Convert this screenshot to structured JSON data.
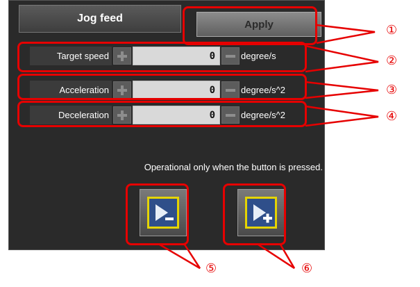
{
  "panel": {
    "title": "Jog feed",
    "apply_label": "Apply",
    "rows": [
      {
        "label": "Target speed",
        "value": "0",
        "unit": "degree/s"
      },
      {
        "label": "Acceleration",
        "value": "0",
        "unit": "degree/s^2"
      },
      {
        "label": "Deceleration",
        "value": "0",
        "unit": "degree/s^2"
      }
    ],
    "note": "Operational only when the button is pressed.",
    "jog_minus_icon": "play-minus-icon",
    "jog_plus_icon": "play-plus-icon"
  },
  "callouts": [
    "①",
    "②",
    "③",
    "④",
    "⑤",
    "⑥"
  ],
  "colors": {
    "callout": "#e60000",
    "panel_bg": "#2a2a2a",
    "jog_frame": "#e5d400",
    "value_bg": "#d9d9d9"
  }
}
